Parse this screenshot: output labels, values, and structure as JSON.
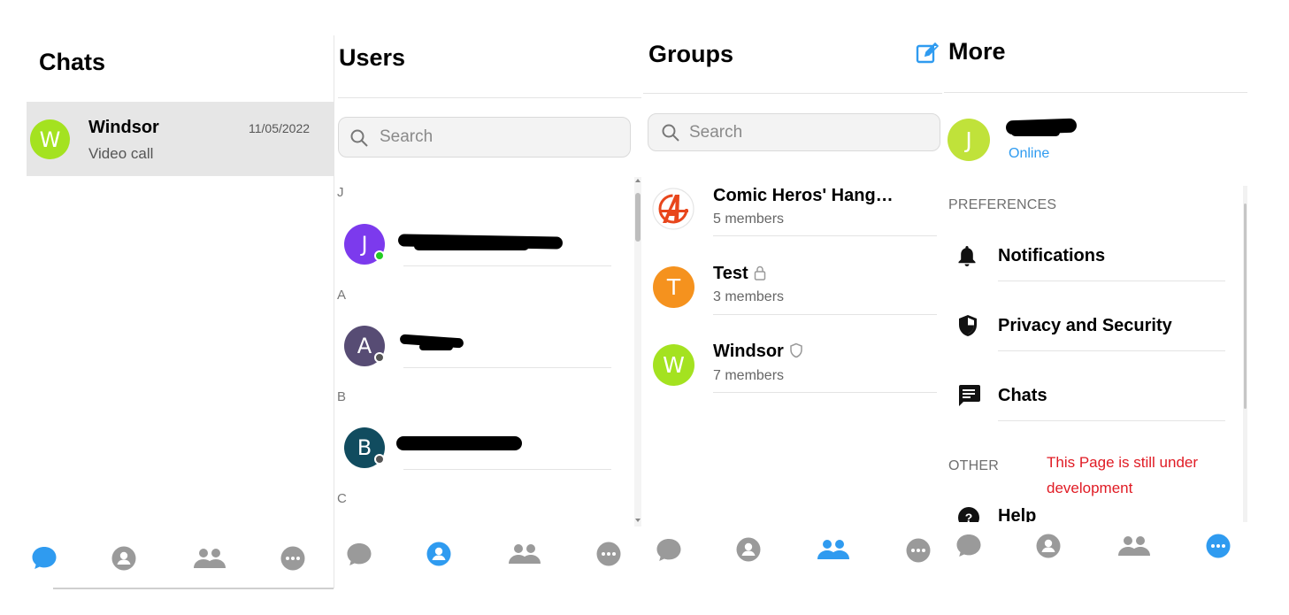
{
  "chats_panel": {
    "title": "Chats",
    "items": [
      {
        "avatar_letter": "W",
        "name": "Windsor",
        "date": "11/05/2022",
        "preview": "Video call",
        "avatar_color": "#a4e220"
      }
    ]
  },
  "users_panel": {
    "title": "Users",
    "search_placeholder": "Search",
    "sections": [
      {
        "letter": "J",
        "avatar_letter": "J",
        "avatar_color": "#7c3aed",
        "status": "online"
      },
      {
        "letter": "A",
        "avatar_letter": "A",
        "avatar_color": "#574c74",
        "status": "offline"
      },
      {
        "letter": "B",
        "avatar_letter": "B",
        "avatar_color": "#114c5f",
        "status": "offline"
      },
      {
        "letter": "C"
      }
    ]
  },
  "groups_panel": {
    "title": "Groups",
    "search_placeholder": "Search",
    "items": [
      {
        "name": "Comic Heros' Hang…",
        "members": "5 members",
        "badge": ""
      },
      {
        "avatar_letter": "T",
        "avatar_color": "#f5921e",
        "name": "Test",
        "members": "3 members",
        "badge": "lock-icon"
      },
      {
        "avatar_letter": "W",
        "avatar_color": "#a4e220",
        "name": "Windsor",
        "members": "7 members",
        "badge": "shield-outline-icon"
      }
    ]
  },
  "more_panel": {
    "title": "More",
    "profile": {
      "avatar_letter": "J",
      "avatar_color": "#c0e23a",
      "status": "Online"
    },
    "preferences_header": "PREFERENCES",
    "preferences": [
      {
        "label": "Notifications",
        "icon": "bell-icon"
      },
      {
        "label": "Privacy and Security",
        "icon": "shield-icon"
      },
      {
        "label": "Chats",
        "icon": "chat-bubble-icon"
      }
    ],
    "other_header": "OTHER",
    "other_first": "Help",
    "dev_notice": "This Page is still under development"
  },
  "colors": {
    "accent": "#2f9bf0",
    "nav_inactive": "#9a9a9a",
    "notice_red": "#e01b24",
    "online_green": "#22cc22",
    "offline_gray": "#555555",
    "selected_row": "#e6e6e6"
  }
}
